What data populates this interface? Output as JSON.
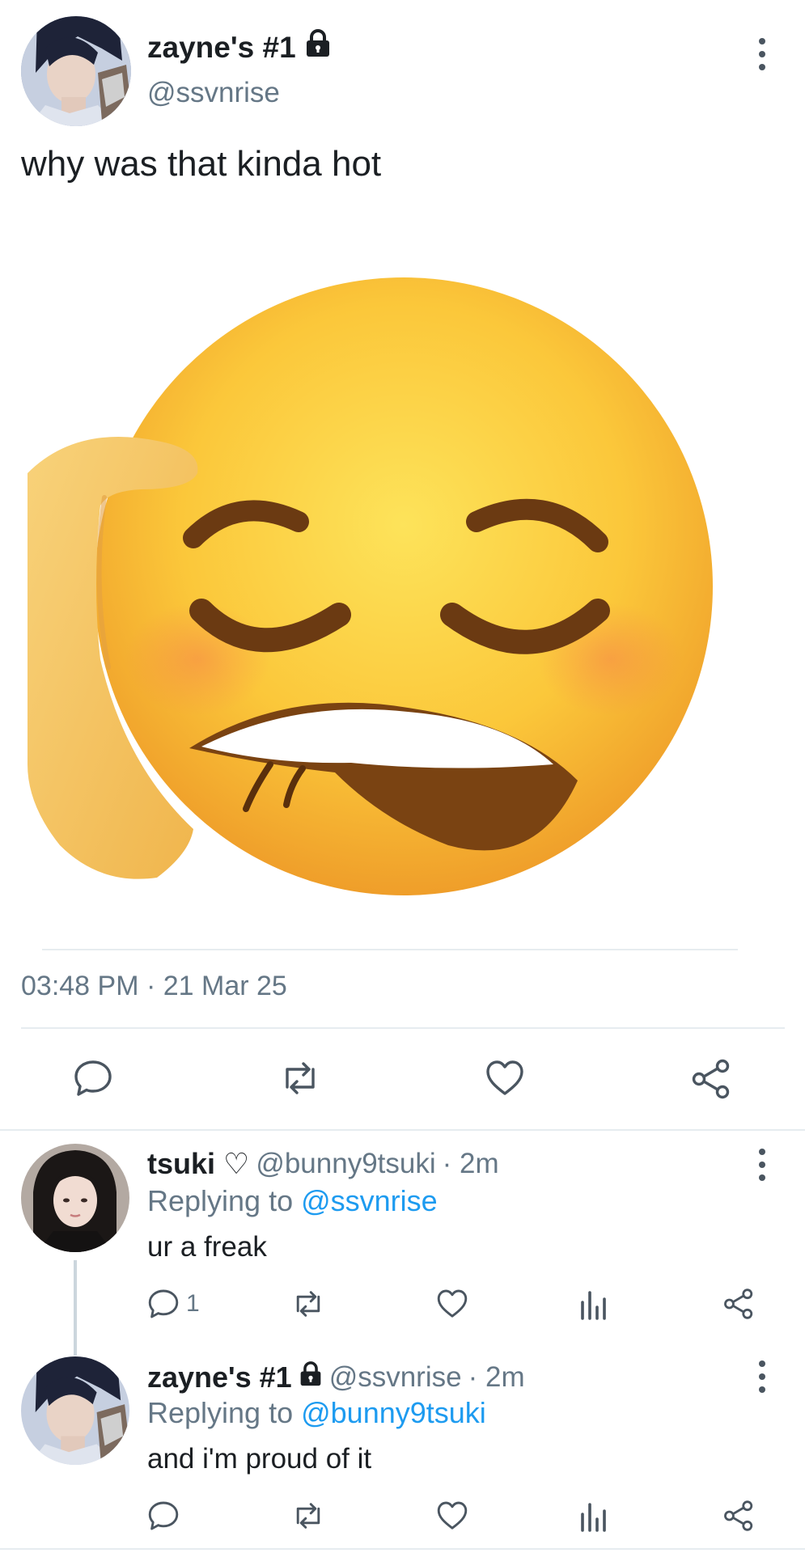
{
  "tweet": {
    "display_name": "zayne's #1",
    "handle": "@ssvnrise",
    "text": "why was that kinda hot",
    "timestamp": "03:48 PM · 21 Mar 25",
    "media_icon": "biting-lip-emoji-image",
    "avatar_icon": "anime-man-avatar"
  },
  "replies": [
    {
      "display_name": "tsuki ♡",
      "handle": "@bunny9tsuki",
      "time": "· 2m",
      "replying_prefix": "Replying to ",
      "replying_to": "@ssvnrise",
      "text": "ur a freak",
      "reply_count": "1",
      "avatar_icon": "girl-photo-avatar"
    },
    {
      "display_name": "zayne's #1",
      "handle": "@ssvnrise",
      "time": "· 2m",
      "replying_prefix": "Replying to ",
      "replying_to": "@bunny9tsuki",
      "text": "and i'm proud of it",
      "reply_count": "",
      "avatar_icon": "anime-man-avatar"
    }
  ],
  "colors": {
    "text": "#1b1f23",
    "muted": "#657786",
    "link": "#1d9bf0",
    "divider": "#e6ecf0"
  }
}
